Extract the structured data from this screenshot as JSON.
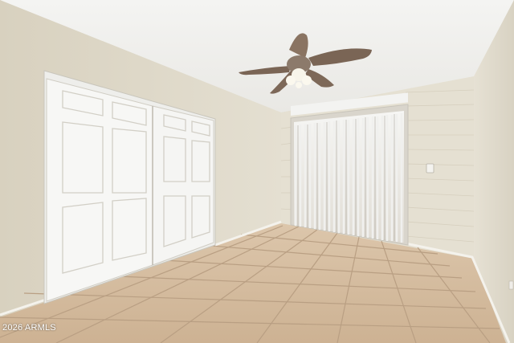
{
  "watermark": "2026 ARMLS",
  "colors": {
    "ceiling": "#f3f3f1",
    "left_wall": "#ddd7c6",
    "back_wall": "#e6e1d4",
    "right_wall": "#e2ddcf",
    "tile": "#d2b79a",
    "grout": "#b79d82",
    "door": "#f6f6f4",
    "fan_blade": "#8a7462",
    "vertical_blinds": "#f1f1f0"
  },
  "icons": [
    "ceiling-fan-icon",
    "sliding-closet-doors",
    "vertical-blinds",
    "light-switch-icon"
  ]
}
